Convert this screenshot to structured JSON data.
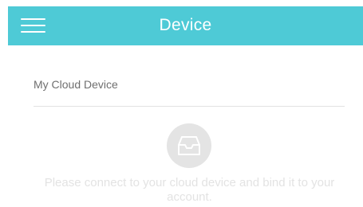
{
  "header": {
    "title": "Device",
    "menu_icon": "hamburger-menu-icon",
    "background_color": "#4ecad6"
  },
  "section": {
    "label": "My Cloud Device"
  },
  "empty_state": {
    "icon": "inbox-tray-icon",
    "message": "Please connect to your cloud device and bind it to your account."
  }
}
